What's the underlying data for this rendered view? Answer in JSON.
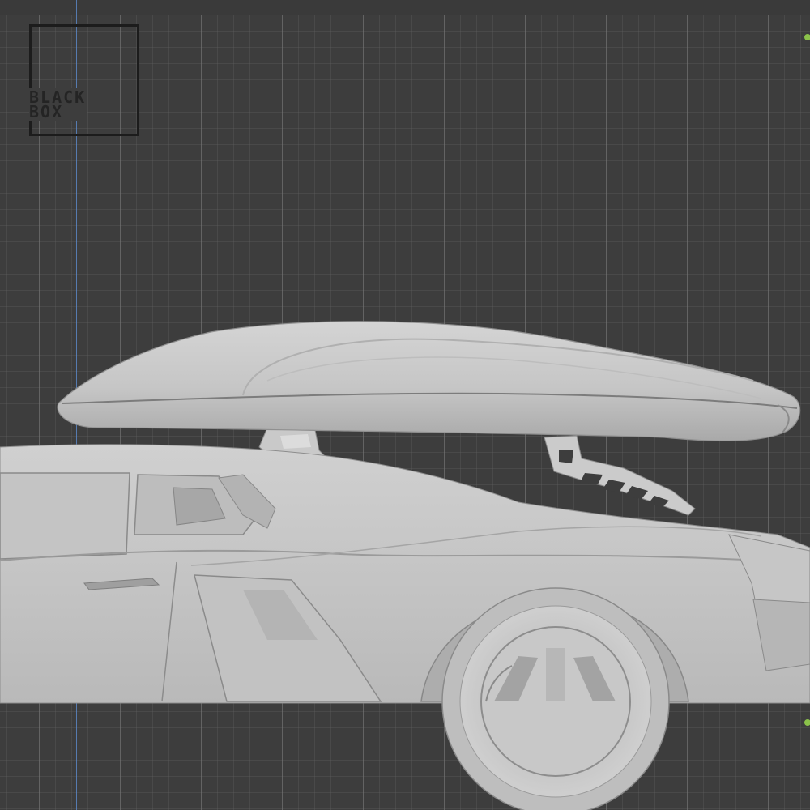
{
  "app": {
    "title": ""
  },
  "logo": {
    "line1": "BLACK",
    "line2": "BOX"
  },
  "scene": {
    "objects": [
      "roof-box",
      "roof-rack",
      "car-body",
      "rear-wheel"
    ],
    "render_color": "#c8c8c8"
  },
  "viewport": {
    "background": "#3d3d3d",
    "grid_major": "#787878",
    "axis_color": "#5b86c4",
    "marker_color": "#8bc24a"
  }
}
